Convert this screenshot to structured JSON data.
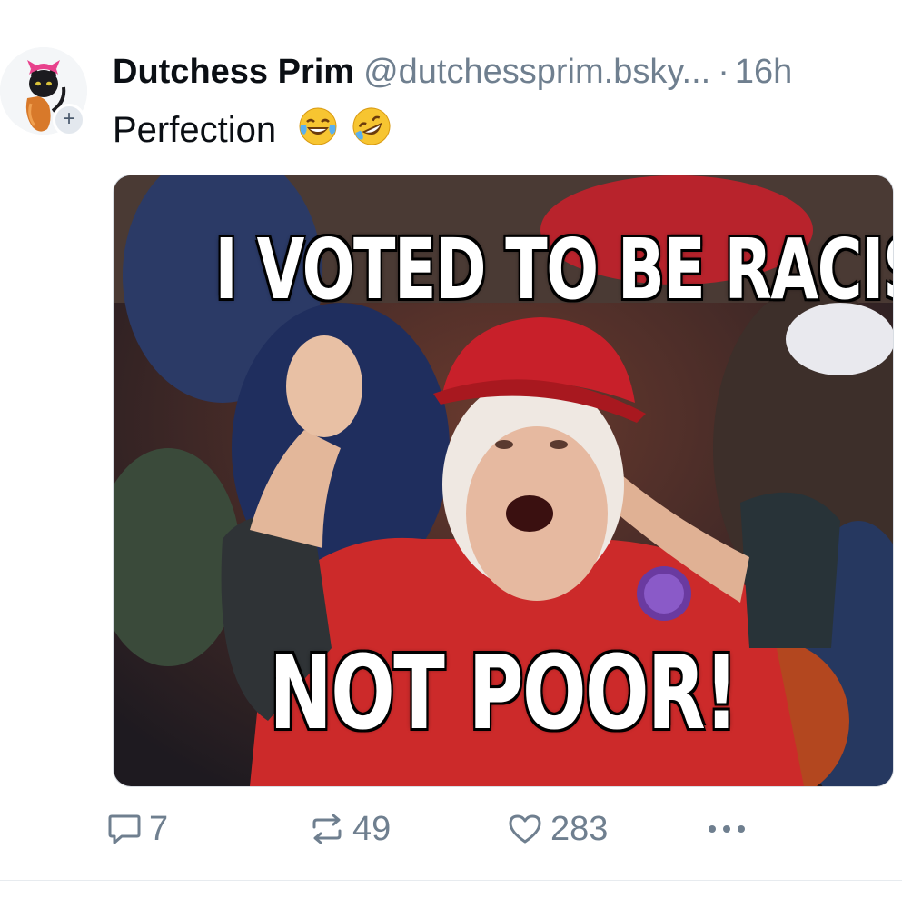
{
  "post": {
    "author": {
      "display_name": "Dutchess Prim",
      "handle": "@dutchessprim.bsky...",
      "avatar_icon": "black-cat-pink-hat-avatar",
      "follow_icon": "plus-icon",
      "follow_label": "+"
    },
    "separator": "·",
    "timestamp": "16h",
    "text": "Perfection",
    "emojis": [
      "😂",
      "🤣"
    ],
    "image": {
      "top_caption": "I VOTED TO BE RACIST",
      "bottom_caption": "NOT POOR!"
    },
    "actions": {
      "reply": {
        "icon": "reply-icon",
        "count": "7"
      },
      "repost": {
        "icon": "repost-icon",
        "count": "49"
      },
      "like": {
        "icon": "heart-icon",
        "count": "283"
      },
      "more": {
        "icon": "more-icon",
        "label": "•••"
      }
    }
  },
  "colors": {
    "text": "#0b0f14",
    "muted": "#6f7f8f",
    "divider": "#e7ebef",
    "hat_red": "#c8202a"
  }
}
